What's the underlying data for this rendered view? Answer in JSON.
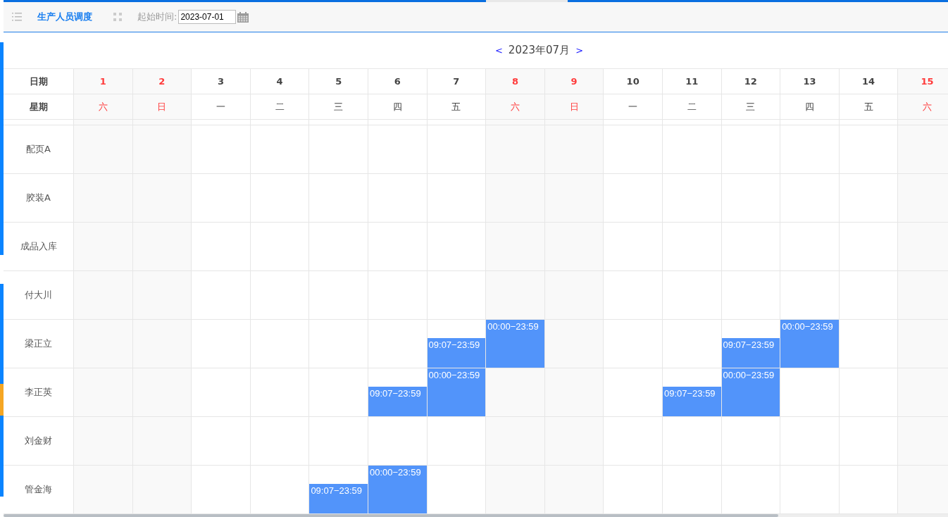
{
  "toolbar": {
    "title": "生产人员调度",
    "start_label": "起始时间:",
    "start_value": "2023-07-01"
  },
  "month": {
    "prev": "<",
    "label": "2023年07月",
    "next": ">"
  },
  "header": {
    "date_label": "日期",
    "weekday_label": "星期"
  },
  "days": [
    {
      "date": "1",
      "weekday": "六",
      "weekend": true
    },
    {
      "date": "2",
      "weekday": "日",
      "weekend": true
    },
    {
      "date": "3",
      "weekday": "一",
      "weekend": false
    },
    {
      "date": "4",
      "weekday": "二",
      "weekend": false
    },
    {
      "date": "5",
      "weekday": "三",
      "weekend": false
    },
    {
      "date": "6",
      "weekday": "四",
      "weekend": false
    },
    {
      "date": "7",
      "weekday": "五",
      "weekend": false
    },
    {
      "date": "8",
      "weekday": "六",
      "weekend": true
    },
    {
      "date": "9",
      "weekday": "日",
      "weekend": true
    },
    {
      "date": "10",
      "weekday": "一",
      "weekend": false
    },
    {
      "date": "11",
      "weekday": "二",
      "weekend": false
    },
    {
      "date": "12",
      "weekday": "三",
      "weekend": false
    },
    {
      "date": "13",
      "weekday": "四",
      "weekend": false
    },
    {
      "date": "14",
      "weekday": "五",
      "weekend": false
    },
    {
      "date": "15",
      "weekday": "六",
      "weekend": true
    }
  ],
  "rows": [
    {
      "name": "配页A",
      "cells": [
        null,
        null,
        null,
        null,
        null,
        null,
        null,
        null,
        null,
        null,
        null,
        null,
        null,
        null,
        null
      ]
    },
    {
      "name": "胶装A",
      "cells": [
        null,
        null,
        null,
        null,
        null,
        null,
        null,
        null,
        null,
        null,
        null,
        null,
        null,
        null,
        null
      ]
    },
    {
      "name": "成品入库",
      "cells": [
        null,
        null,
        null,
        null,
        null,
        null,
        null,
        null,
        null,
        null,
        null,
        null,
        null,
        null,
        null
      ]
    },
    {
      "name": "付大川",
      "cells": [
        null,
        null,
        null,
        null,
        null,
        null,
        null,
        null,
        null,
        null,
        null,
        null,
        null,
        null,
        null
      ]
    },
    {
      "name": "梁正立",
      "cells": [
        null,
        null,
        null,
        null,
        null,
        null,
        {
          "time": "09:07−23:59",
          "kind": "partial"
        },
        {
          "time": "00:00−23:59",
          "kind": "full"
        },
        null,
        null,
        null,
        {
          "time": "09:07−23:59",
          "kind": "partial"
        },
        {
          "time": "00:00−23:59",
          "kind": "full"
        },
        null,
        null
      ]
    },
    {
      "name": "李正英",
      "cells": [
        null,
        null,
        null,
        null,
        null,
        {
          "time": "09:07−23:59",
          "kind": "partial"
        },
        {
          "time": "00:00−23:59",
          "kind": "full"
        },
        null,
        null,
        null,
        {
          "time": "09:07−23:59",
          "kind": "partial"
        },
        {
          "time": "00:00−23:59",
          "kind": "full"
        },
        null,
        null,
        null
      ]
    },
    {
      "name": "刘金财",
      "cells": [
        null,
        null,
        null,
        null,
        null,
        null,
        null,
        null,
        null,
        null,
        null,
        null,
        null,
        null,
        null
      ]
    },
    {
      "name": "管金海",
      "cells": [
        null,
        null,
        null,
        null,
        {
          "time": "09:07−23:59",
          "kind": "partial"
        },
        {
          "time": "00:00−23:59",
          "kind": "full"
        },
        null,
        null,
        null,
        null,
        null,
        null,
        null,
        null,
        null
      ]
    }
  ]
}
